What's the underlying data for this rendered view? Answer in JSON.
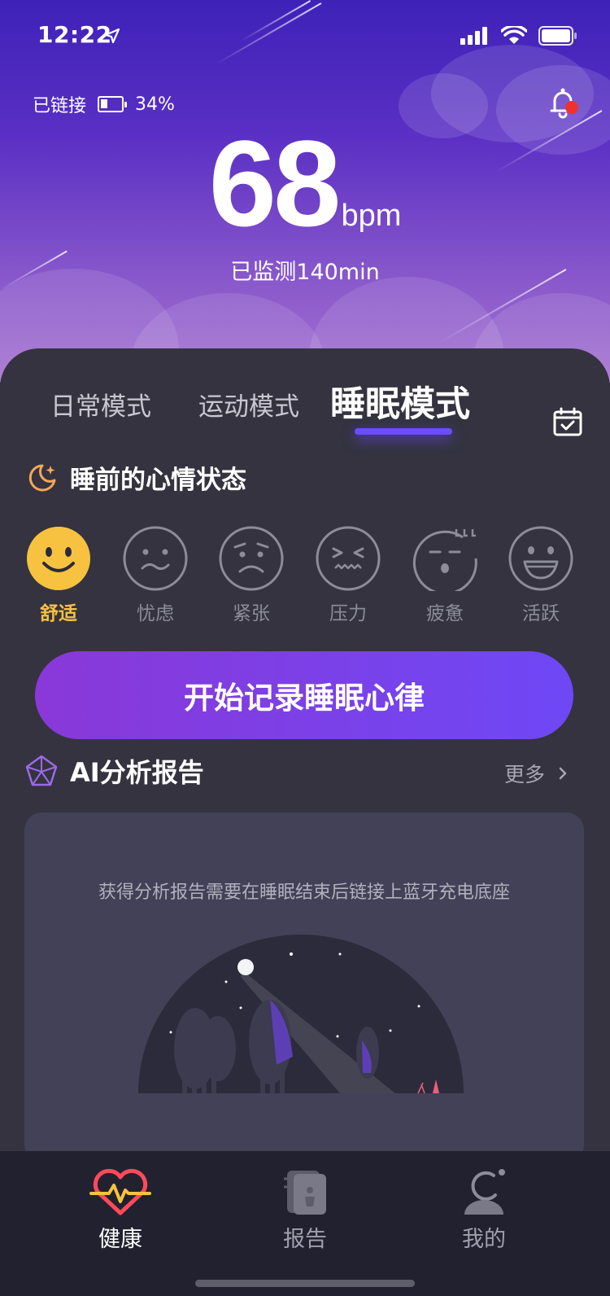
{
  "status_bar": {
    "time": "12:22"
  },
  "device": {
    "connection": "已链接",
    "battery": "34%"
  },
  "heart_rate": {
    "value": "68",
    "unit": "bpm",
    "monitored": "已监测140min"
  },
  "tabs": [
    {
      "label": "日常模式",
      "active": false
    },
    {
      "label": "运动模式",
      "active": false
    },
    {
      "label": "睡眠模式",
      "active": true
    }
  ],
  "mood_section": {
    "title": "睡前的心情状态"
  },
  "moods": [
    {
      "label": "舒适",
      "icon": "smile-face-icon",
      "selected": true
    },
    {
      "label": "忧虑",
      "icon": "worried-face-icon",
      "selected": false
    },
    {
      "label": "紧张",
      "icon": "nervous-face-icon",
      "selected": false
    },
    {
      "label": "压力",
      "icon": "stressed-face-icon",
      "selected": false
    },
    {
      "label": "疲惫",
      "icon": "tired-face-icon",
      "selected": false
    },
    {
      "label": "活跃",
      "icon": "lively-face-icon",
      "selected": false
    }
  ],
  "start_button": "开始记录睡眠心律",
  "ai_report": {
    "title": "AI分析报告",
    "more": "更多",
    "hint": "获得分析报告需要在睡眠结束后链接上蓝牙充电底座"
  },
  "nav": [
    {
      "label": "健康",
      "icon": "heart-pulse-icon",
      "active": true
    },
    {
      "label": "报告",
      "icon": "report-icon",
      "active": false
    },
    {
      "label": "我的",
      "icon": "profile-icon",
      "active": false
    }
  ],
  "colors": {
    "accent": "#6b4cff",
    "mood_selected": "#f7c240",
    "alert_dot": "#f0322f"
  }
}
